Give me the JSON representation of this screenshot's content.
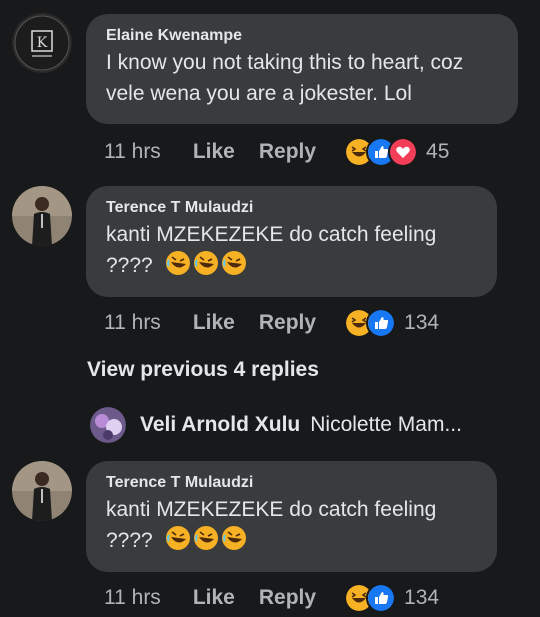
{
  "comments": [
    {
      "author": "Elaine Kwenampe",
      "text": "I know you not taking this to heart, coz vele wena you are a jokester. Lol",
      "time": "11 hrs",
      "like": "Like",
      "reply": "Reply",
      "reactions": [
        "haha-icon",
        "like-icon",
        "love-icon"
      ],
      "count": "45"
    },
    {
      "author": "Terence T Mulaudzi",
      "text": "kanti MZEKEZEKE do catch feeling ????",
      "time": "11 hrs",
      "like": "Like",
      "reply": "Reply",
      "reactions": [
        "haha-icon",
        "like-icon"
      ],
      "count": "134"
    },
    {
      "author": "Terence T Mulaudzi",
      "text": "kanti MZEKEZEKE do catch feeling ????",
      "time": "11 hrs",
      "like": "Like",
      "reply": "Reply",
      "reactions": [
        "haha-icon",
        "like-icon"
      ],
      "count": "134"
    }
  ],
  "view_previous": "View previous 4 replies",
  "reply_preview": {
    "name": "Veli Arnold Xulu",
    "snippet": "Nicolette Mam..."
  },
  "colors": {
    "bg": "#18191a",
    "bubble": "#3a3b3c",
    "muted": "#b0b3b8",
    "like_blue": "#1877f2",
    "love_red": "#f33e58",
    "haha_yellow": "#f7b125"
  }
}
